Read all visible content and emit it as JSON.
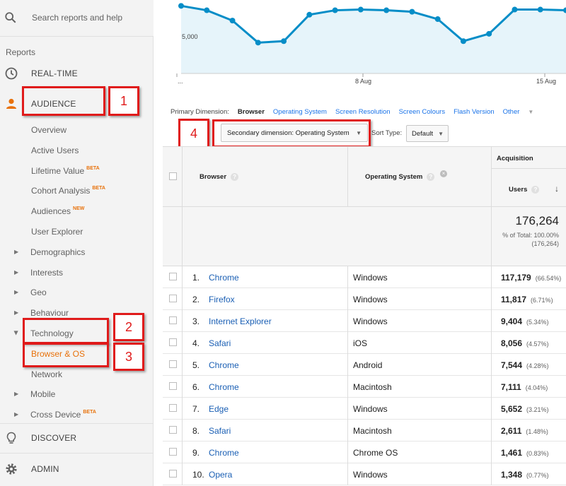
{
  "sidebar": {
    "search_placeholder": "Search reports and help",
    "reports_label": "Reports",
    "realtime": "REAL-TIME",
    "audience": "AUDIENCE",
    "audience_items": [
      {
        "label": "Overview",
        "badge": ""
      },
      {
        "label": "Active Users",
        "badge": ""
      },
      {
        "label": "Lifetime Value",
        "badge": "BETA"
      },
      {
        "label": "Cohort Analysis",
        "badge": "BETA"
      },
      {
        "label": "Audiences",
        "badge": "NEW"
      },
      {
        "label": "User Explorer",
        "badge": ""
      }
    ],
    "expand_items": [
      "Demographics",
      "Interests",
      "Geo",
      "Behaviour"
    ],
    "technology": "Technology",
    "browser_os": "Browser & OS",
    "network": "Network",
    "mobile": "Mobile",
    "cross_device": "Cross Device",
    "cross_device_badge": "BETA",
    "discover": "DISCOVER",
    "admin": "ADMIN",
    "accent_color": "#e8710a"
  },
  "annotations": [
    "1",
    "2",
    "3",
    "4"
  ],
  "chart": {
    "y_label": "5,000",
    "x_labels": [
      "...",
      "8 Aug",
      "15 Aug"
    ],
    "line_color": "#058dc7",
    "fill_color": "#e6f4fa"
  },
  "chart_data": {
    "type": "area",
    "series": [
      {
        "values": [
          0.92,
          0.86,
          0.72,
          0.42,
          0.44,
          0.8,
          0.86,
          0.87,
          0.86,
          0.84,
          0.74,
          0.44,
          0.54,
          0.87,
          0.87,
          0.86
        ]
      }
    ],
    "y_tick": "5,000",
    "x_ticks": [
      "...",
      "8 Aug",
      "15 Aug"
    ]
  },
  "primary_dimension": {
    "label": "Primary Dimension:",
    "active": "Browser",
    "options": [
      "Operating System",
      "Screen Resolution",
      "Screen Colours",
      "Flash Version"
    ],
    "other": "Other"
  },
  "toolbar": {
    "secondary_dimension": "Secondary dimension: Operating System",
    "sort_type_label": "Sort Type:",
    "sort_type_value": "Default"
  },
  "table": {
    "col_browser": "Browser",
    "col_os": "Operating System",
    "group_acquisition": "Acquisition",
    "col_users": "Users",
    "total": "176,264",
    "total_pct_line": "% of Total: 100.00%",
    "total_abs_line": "(176,264)",
    "rows": [
      {
        "idx": "1.",
        "browser": "Chrome",
        "os": "Windows",
        "users": "117,179",
        "pct": "(66.54%)"
      },
      {
        "idx": "2.",
        "browser": "Firefox",
        "os": "Windows",
        "users": "11,817",
        "pct": "(6.71%)"
      },
      {
        "idx": "3.",
        "browser": "Internet Explorer",
        "os": "Windows",
        "users": "9,404",
        "pct": "(5.34%)"
      },
      {
        "idx": "4.",
        "browser": "Safari",
        "os": "iOS",
        "users": "8,056",
        "pct": "(4.57%)"
      },
      {
        "idx": "5.",
        "browser": "Chrome",
        "os": "Android",
        "users": "7,544",
        "pct": "(4.28%)"
      },
      {
        "idx": "6.",
        "browser": "Chrome",
        "os": "Macintosh",
        "users": "7,111",
        "pct": "(4.04%)"
      },
      {
        "idx": "7.",
        "browser": "Edge",
        "os": "Windows",
        "users": "5,652",
        "pct": "(3.21%)"
      },
      {
        "idx": "8.",
        "browser": "Safari",
        "os": "Macintosh",
        "users": "2,611",
        "pct": "(1.48%)"
      },
      {
        "idx": "9.",
        "browser": "Chrome",
        "os": "Chrome OS",
        "users": "1,461",
        "pct": "(0.83%)"
      },
      {
        "idx": "10.",
        "browser": "Opera",
        "os": "Windows",
        "users": "1,348",
        "pct": "(0.77%)"
      }
    ]
  }
}
